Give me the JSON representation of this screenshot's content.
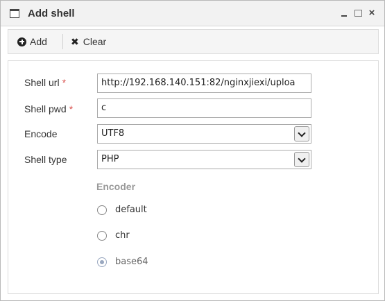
{
  "window": {
    "title": "Add shell",
    "controls": {
      "minimize": "minimize",
      "maximize": "maximize",
      "close": "×"
    }
  },
  "toolbar": {
    "add_label": "Add",
    "clear_label": "Clear"
  },
  "form": {
    "shell_url": {
      "label": "Shell url",
      "required_mark": "*",
      "value": "http://192.168.140.151:82/nginxjiexi/uploa"
    },
    "shell_pwd": {
      "label": "Shell pwd",
      "required_mark": "*",
      "value": "c"
    },
    "encode": {
      "label": "Encode",
      "selected": "UTF8"
    },
    "shell_type": {
      "label": "Shell type",
      "selected": "PHP"
    }
  },
  "encoder": {
    "title": "Encoder",
    "options": [
      {
        "label": "default",
        "checked": false
      },
      {
        "label": "chr",
        "checked": false
      },
      {
        "label": "base64",
        "checked": true
      }
    ]
  },
  "icons": {
    "window": "window-icon",
    "add": "plus-circle-icon",
    "clear": "x-icon",
    "select": "chevron-down-icon"
  }
}
